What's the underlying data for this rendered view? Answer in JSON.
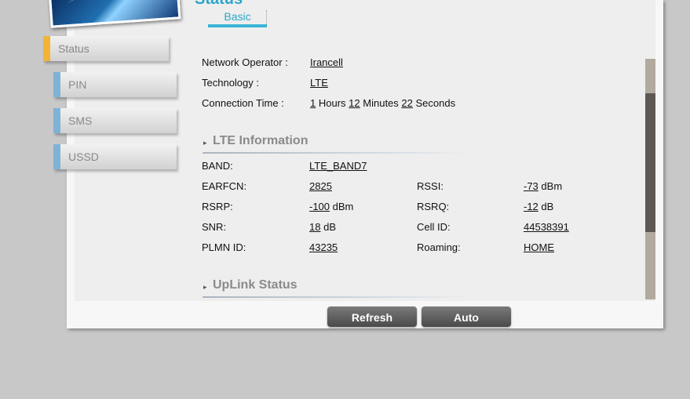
{
  "header": {
    "title": "Status"
  },
  "sidebar": {
    "items": [
      {
        "label": "Status"
      },
      {
        "label": "PIN"
      },
      {
        "label": "SMS"
      },
      {
        "label": "USSD"
      }
    ]
  },
  "tabs": [
    {
      "label": "Basic"
    }
  ],
  "basic_info": {
    "network_operator": {
      "label": "Network Operator :",
      "value": "Irancell"
    },
    "technology": {
      "label": "Technology :",
      "value": "LTE"
    },
    "connection_time": {
      "label": "Connection Time :",
      "hours": "1",
      "hours_unit": "Hours",
      "minutes": "12",
      "minutes_unit": "Minutes",
      "seconds": "22",
      "seconds_unit": "Seconds"
    }
  },
  "lte": {
    "title": "LTE Information",
    "band": {
      "label": "BAND:",
      "value": "LTE_BAND7"
    },
    "earfcn": {
      "label": "EARFCN:",
      "value": "2825"
    },
    "rssi": {
      "label": "RSSI:",
      "value": "-73",
      "unit": "dBm"
    },
    "rsrp": {
      "label": "RSRP:",
      "value": "-100",
      "unit": "dBm"
    },
    "rsrq": {
      "label": "RSRQ:",
      "value": "-12",
      "unit": "dB"
    },
    "snr": {
      "label": "SNR:",
      "value": "18",
      "unit": "dB"
    },
    "cell_id": {
      "label": "Cell ID:",
      "value": "44538391"
    },
    "plmn_id": {
      "label": "PLMN ID:",
      "value": "43235"
    },
    "roaming": {
      "label": "Roaming:",
      "value": "HOME"
    }
  },
  "uplink": {
    "title": "UpLink Status"
  },
  "buttons": {
    "refresh": "Refresh",
    "auto": "Auto"
  },
  "colors": {
    "accent": "#2aa6c9",
    "active_menu": "#f2b437",
    "sub_menu": "#7fb3d6",
    "button": "#5a5a5a"
  }
}
